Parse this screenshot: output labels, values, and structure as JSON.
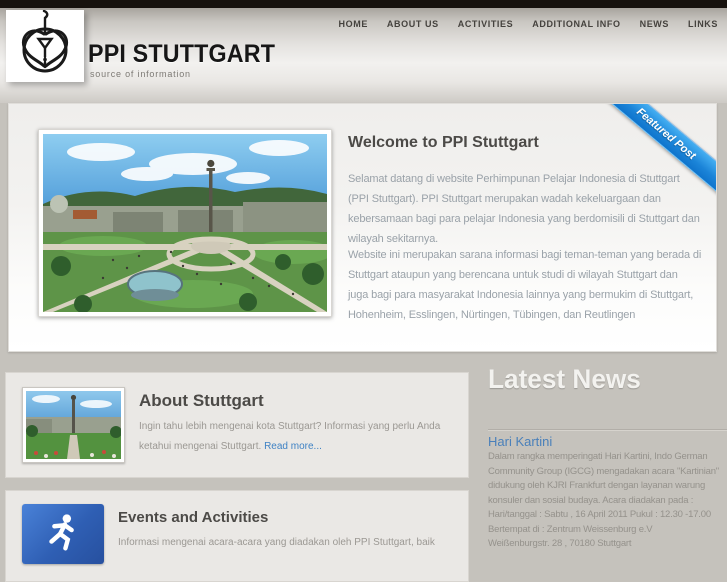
{
  "header": {
    "site_title": "PPI STUTTGART",
    "tagline": "source of information",
    "logo_icon": "ppi-emblem-icon",
    "nav": [
      {
        "label": "HOME"
      },
      {
        "label": "ABOUT US"
      },
      {
        "label": "ACTIVITIES"
      },
      {
        "label": "ADDITIONAL INFO"
      },
      {
        "label": "NEWS"
      },
      {
        "label": "LINKS"
      }
    ]
  },
  "featured_post": {
    "ribbon_label": "Featured Post",
    "heading": "Welcome to PPI Stuttgart",
    "photo_icon": "stuttgart-schlossplatz-aerial-photo",
    "paragraph_1": "Selamat datang di website Perhimpunan Pelajar Indonesia di Stuttgart\n(PPI Stuttgart). PPI Stuttgart merupakan wadah kekeluargaan dan\nkebersamaan bagi para pelajar Indonesia yang berdomisili di Stuttgart dan\nwilayah sekitarnya.",
    "paragraph_2": "Website ini merupakan sarana informasi bagi teman-teman yang berada di\nStuttgart ataupun yang berencana untuk studi di wilayah Stuttgart dan\njuga bagi para masyarakat Indonesia lainnya yang bermukim di Stuttgart,\nHohenheim, Esslingen, Nürtingen, Tübingen, dan Reutlingen"
  },
  "about": {
    "heading": "About Stuttgart",
    "thumb_icon": "schlossplatz-column-thumbnail",
    "text": "Ingin tahu lebih mengenai kota Stuttgart? Informasi yang perlu Anda\nketahui mengenai Stuttgart. ",
    "read_more_label": "Read more..."
  },
  "events": {
    "heading": "Events and Activities",
    "icon": "runner-icon",
    "text": "Informasi mengenai acara-acara yang diadakan oleh PPI Stuttgart, baik"
  },
  "latest_news": {
    "heading": "Latest News",
    "post_title": "Hari Kartini",
    "post_body": "Dalam rangka memperingati Hari Kartini, Indo German\nCommunity Group (IGCG) mengadakan acara \"Kartinian\"\ndidukung oleh KJRI Frankfurt dengan layanan warung\nkonsuler dan sosial budaya. Acara diadakan pada :\nHari/tanggal : Sabtu , 16 April 2011 Pukul : 12.30 -17.00\nBertempat di : Zentrum Weissenburg e.V\nWeißenburgstr. 28 , 70180 Stuttgart"
  },
  "colors": {
    "topbar_black": "#17120e",
    "page_background": "#c5c2bc",
    "ribbon_blue_top": "#45aff2",
    "ribbon_blue_bottom": "#0f74cc",
    "link_blue": "#3f82c4",
    "event_icon_blue": "#2f5fb4"
  }
}
